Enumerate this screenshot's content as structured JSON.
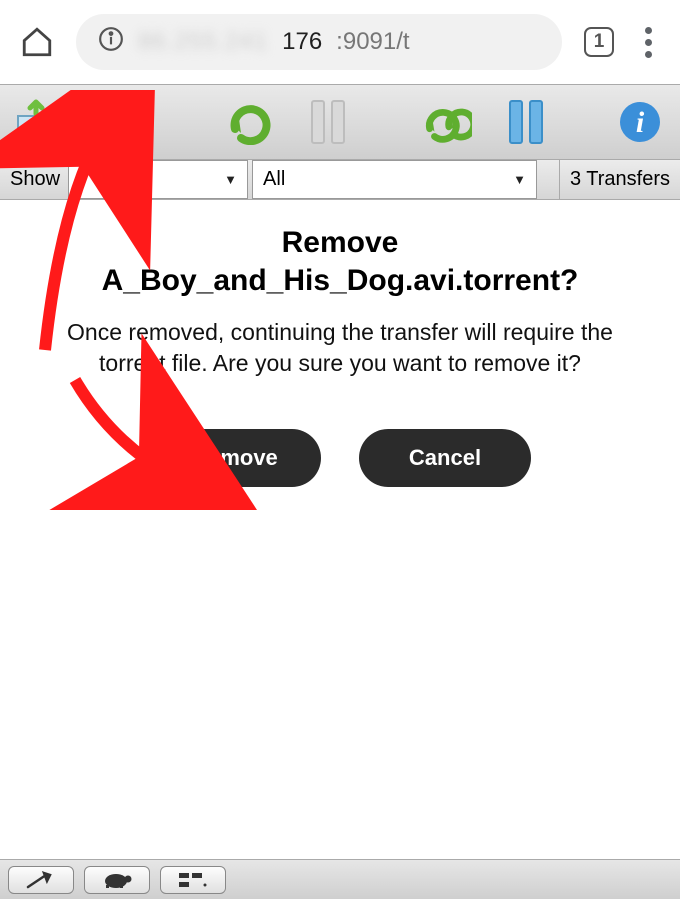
{
  "browser": {
    "url_hidden": "86.255.241",
    "url_main": "176",
    "url_tail": ":9091/t",
    "tab_count": "1"
  },
  "filter": {
    "show_label": "Show",
    "select1": "",
    "select2": "All",
    "transfers": "3 Transfers"
  },
  "dialog": {
    "title_line1": "Remove",
    "title_line2": "A_Boy_and_His_Dog.avi.torrent?",
    "body": "Once removed, continuing the transfer will require the torrent file. Are you sure you want to remove it?",
    "remove": "Remove",
    "cancel": "Cancel"
  }
}
